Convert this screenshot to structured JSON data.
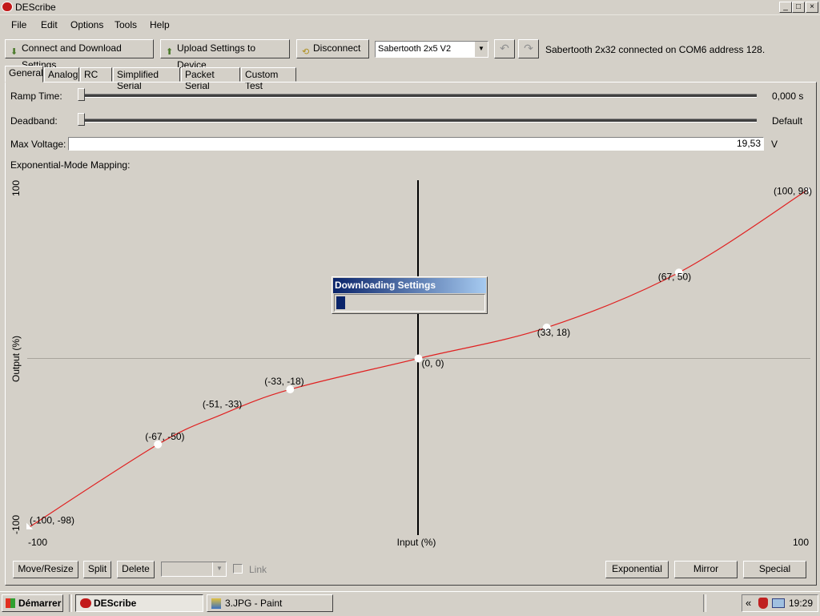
{
  "window": {
    "title": "DEScribe",
    "minimize_label": "_",
    "maximize_label": "□",
    "close_label": "×"
  },
  "menu": {
    "items": [
      "File",
      "Edit",
      "Options",
      "Tools",
      "Help"
    ]
  },
  "toolbar": {
    "connect_label": "Connect and Download Settings",
    "upload_label": "Upload Settings to Device",
    "disconnect_label": "Disconnect",
    "device_selected": "Sabertooth 2x5 V2",
    "undo_icon": "undo-arrow-icon",
    "redo_icon": "redo-arrow-icon",
    "status": "Sabertooth 2x32 connected on COM6 address 128."
  },
  "tabs": [
    "General",
    "Analog",
    "RC",
    "Simplified Serial",
    "Packet Serial",
    "Custom Test"
  ],
  "active_tab": "General",
  "settings": {
    "ramp_label": "Ramp Time:",
    "ramp_value": "0,000 s",
    "ramp_level": 0,
    "deadband_label": "Deadband:",
    "deadband_value": "Default",
    "deadband_level": 0,
    "maxv_label": "Max Voltage:",
    "maxv_value": "19,53",
    "maxv_unit": "V"
  },
  "mapping": {
    "title": "Exponential-Mode Mapping:",
    "chart_data": {
      "type": "line",
      "title": "",
      "xlabel": "Input (%)",
      "ylabel": "Output (%)",
      "xlim": [
        -100,
        100
      ],
      "ylim": [
        -100,
        100
      ],
      "x_tick_labels": [
        "-100",
        "100"
      ],
      "y_tick_labels": [
        "100",
        "-100"
      ],
      "grid": false,
      "series": [
        {
          "color": "#e02020",
          "x": [
            -100,
            -67,
            -51,
            -33,
            0,
            33,
            67,
            100
          ],
          "y": [
            -98,
            -50,
            -33,
            -18,
            0,
            18,
            50,
            98
          ]
        }
      ],
      "point_labels": [
        "(-100, -98)",
        "(-67, -50)",
        "(-51, -33)",
        "(-33, -18)",
        "(0, 0)",
        "(33, 18)",
        "(67, 50)",
        "(100, 98)"
      ],
      "control_points": [
        -67,
        -33,
        0,
        33,
        67
      ]
    }
  },
  "dialog": {
    "title": "Downloading Settings",
    "progress": 0.06
  },
  "bottom": {
    "move_resize_label": "Move/Resize",
    "split_label": "Split",
    "delete_label": "Delete",
    "link_label": "Link",
    "exponential_label": "Exponential",
    "mirror_label": "Mirror",
    "special_label": "Special"
  },
  "taskbar": {
    "start_label": "Démarrer",
    "tasks": [
      "DEScribe",
      "3.JPG - Paint"
    ],
    "tray_chevron": "«",
    "clock": "19:29"
  },
  "colors": {
    "curve": "#e02020",
    "titlebar_active": "#0a246a",
    "progress": "#0a246a"
  }
}
